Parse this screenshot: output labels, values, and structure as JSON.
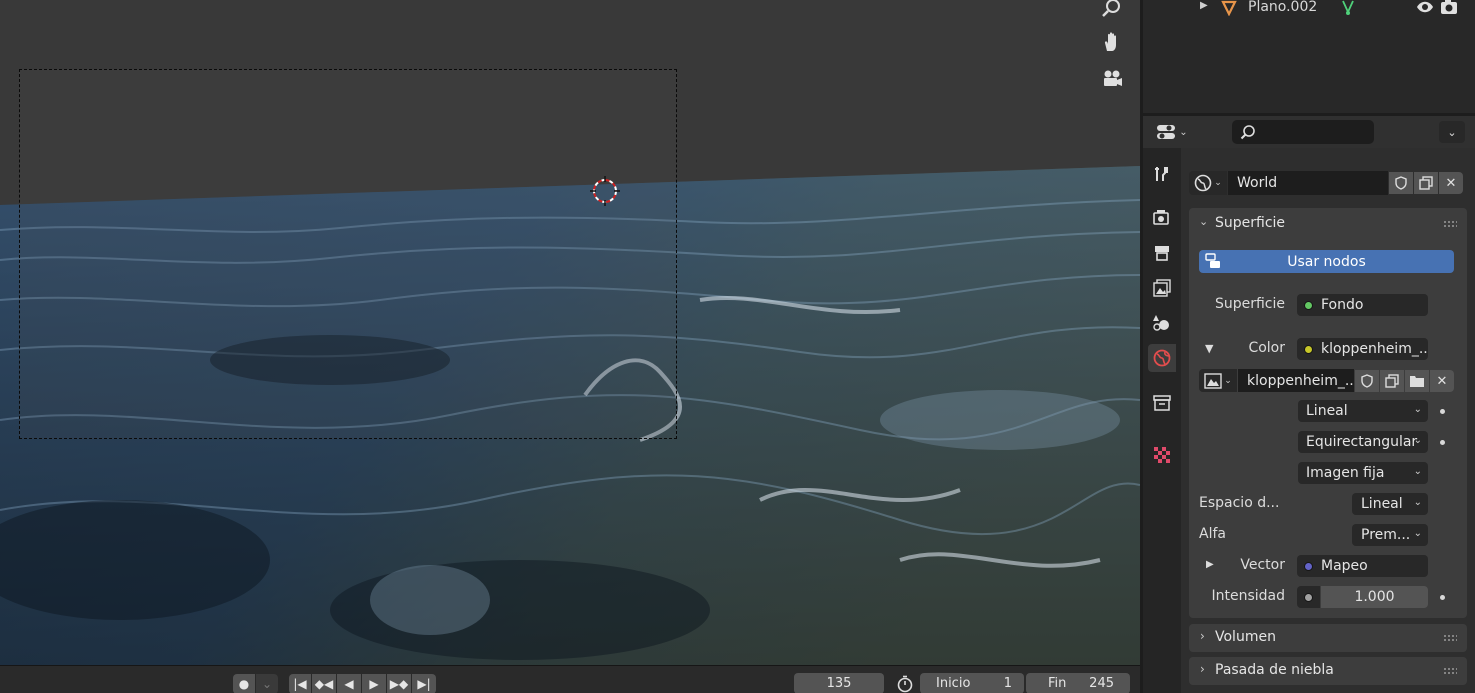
{
  "outliner": {
    "object_name": "Plano.002"
  },
  "properties": {
    "search": {
      "placeholder": ""
    },
    "world_name": "World",
    "surface_panel": {
      "title": "Superficie",
      "use_nodes_label": "Usar nodos",
      "surface_label": "Superficie",
      "surface_value": "Fondo",
      "color_label": "Color",
      "color_value": "kloppenheim_...",
      "image_name": "kloppenheim_...",
      "interpolation": "Lineal",
      "projection": "Equirectangular",
      "extension": "Imagen fija",
      "colorspace_label": "Espacio d...",
      "colorspace_value": "Lineal",
      "alpha_label": "Alfa",
      "alpha_value": "Prem...",
      "vector_label": "Vector",
      "vector_value": "Mapeo",
      "strength_label": "Intensidad",
      "strength_value": "1.000"
    },
    "volume_panel": {
      "title": "Volumen"
    },
    "mist_panel": {
      "title": "Pasada de niebla"
    }
  },
  "timeline": {
    "current_frame": "135",
    "start_label": "Inicio",
    "start_value": "1",
    "end_label": "Fin",
    "end_value": "245"
  },
  "colors": {
    "accent_blue": "#4772b3",
    "socket_green": "#63c763",
    "socket_yellow": "#c7c729",
    "socket_purple": "#6363c7",
    "socket_gray": "#a1a1a1",
    "world_tab_red": "#e34d4d"
  }
}
